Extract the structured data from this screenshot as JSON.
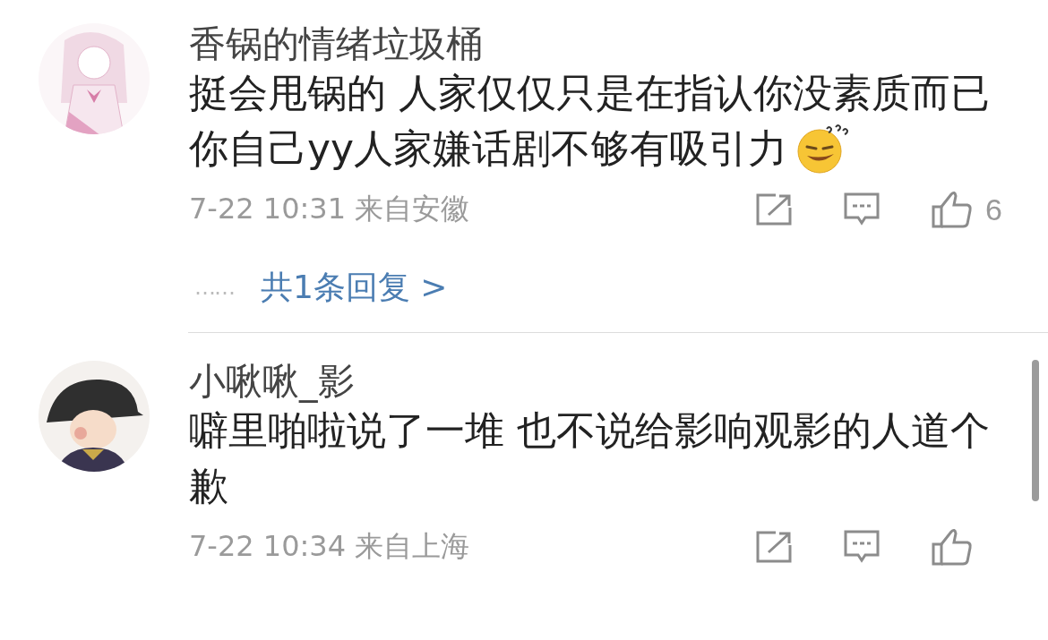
{
  "comments": [
    {
      "user": "香锅的情绪垃圾桶",
      "lines": [
        "挺会甩锅的 人家仅仅只是在指认你没素质而已",
        "你自己yy人家嫌话剧不够有吸引力"
      ],
      "emoji_after_last_line": true,
      "meta": "7-22 10:31 来自安徽",
      "likes": "6",
      "replies": {
        "dots": "……",
        "link": "共1条回复 >"
      }
    },
    {
      "user": "小啾啾_影",
      "lines": [
        "噼里啪啦说了一堆 也不说给影响观影的人道个",
        "歉"
      ],
      "emoji_after_last_line": false,
      "meta": "7-22 10:34 来自上海"
    }
  ]
}
